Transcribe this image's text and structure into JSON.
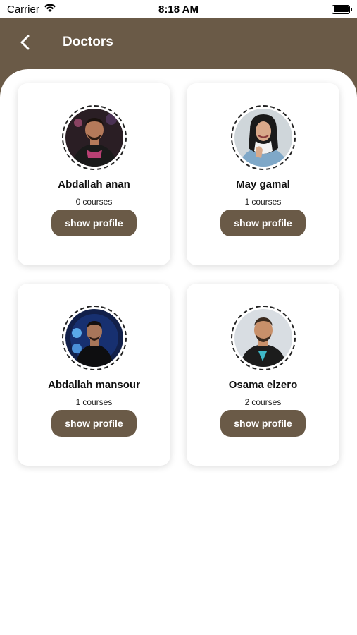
{
  "status_bar": {
    "carrier": "Carrier",
    "time": "8:18 AM"
  },
  "header": {
    "title": "Doctors",
    "back_icon": "chevron-left-icon"
  },
  "colors": {
    "brand": "#6a5a47",
    "background": "#ffffff"
  },
  "doctors": [
    {
      "name": "Abdallah anan",
      "courses_count": "0",
      "courses_label": "courses",
      "button_label": "show profile"
    },
    {
      "name": "May gamal",
      "courses_count": "1",
      "courses_label": "courses",
      "button_label": "show profile"
    },
    {
      "name": "Abdallah mansour",
      "courses_count": "1",
      "courses_label": "courses",
      "button_label": "show profile"
    },
    {
      "name": "Osama elzero",
      "courses_count": "2",
      "courses_label": "courses",
      "button_label": "show profile"
    }
  ]
}
